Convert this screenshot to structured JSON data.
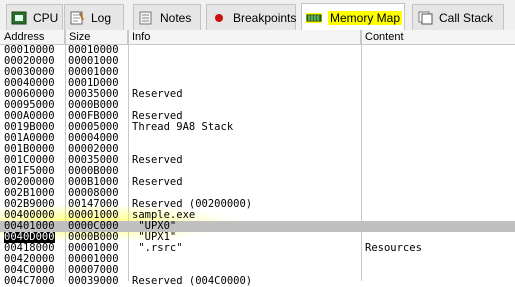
{
  "tabs": [
    {
      "label": "CPU",
      "icon": "cpu-icon",
      "active": false
    },
    {
      "label": "Log",
      "icon": "log-icon",
      "active": false
    },
    {
      "label": "Notes",
      "icon": "notes-icon",
      "active": false
    },
    {
      "label": "Breakpoints",
      "icon": "breakpoint-icon",
      "active": false
    },
    {
      "label": "Memory Map",
      "icon": "memory-map-icon",
      "active": true
    },
    {
      "label": "Call Stack",
      "icon": "call-stack-icon",
      "active": false
    }
  ],
  "columns": [
    "Address",
    "Size",
    "Info",
    "Content"
  ],
  "rows": [
    {
      "address": "00010000",
      "size": "00010000",
      "info": "",
      "content": ""
    },
    {
      "address": "00020000",
      "size": "00001000",
      "info": "",
      "content": ""
    },
    {
      "address": "00030000",
      "size": "00001000",
      "info": "",
      "content": ""
    },
    {
      "address": "00040000",
      "size": "0001D000",
      "info": "",
      "content": ""
    },
    {
      "address": "00060000",
      "size": "00035000",
      "info": "Reserved",
      "content": ""
    },
    {
      "address": "00095000",
      "size": "0000B000",
      "info": "",
      "content": ""
    },
    {
      "address": "000A0000",
      "size": "000FB000",
      "info": "Reserved",
      "content": ""
    },
    {
      "address": "0019B000",
      "size": "00005000",
      "info": "Thread 9A8 Stack",
      "content": ""
    },
    {
      "address": "001A0000",
      "size": "00004000",
      "info": "",
      "content": ""
    },
    {
      "address": "001B0000",
      "size": "00002000",
      "info": "",
      "content": ""
    },
    {
      "address": "001C0000",
      "size": "00035000",
      "info": "Reserved",
      "content": ""
    },
    {
      "address": "001F5000",
      "size": "0000B000",
      "info": "",
      "content": ""
    },
    {
      "address": "00200000",
      "size": "000B1000",
      "info": "Reserved",
      "content": ""
    },
    {
      "address": "002B1000",
      "size": "00008000",
      "info": "",
      "content": ""
    },
    {
      "address": "002B9000",
      "size": "00147000",
      "info": "Reserved (00200000)",
      "content": ""
    },
    {
      "address": "00400000",
      "size": "00001000",
      "info": "sample.exe",
      "content": ""
    },
    {
      "address": "00401000",
      "size": "0000C000",
      "info": " \"UPX0\"",
      "content": ""
    },
    {
      "address": "0040D000",
      "size": "0000B000",
      "info": " \"UPX1\"",
      "content": ""
    },
    {
      "address": "00418000",
      "size": "00001000",
      "info": " \".rsrc\"",
      "content": "Resources"
    },
    {
      "address": "00420000",
      "size": "00001000",
      "info": "",
      "content": ""
    },
    {
      "address": "004C0000",
      "size": "00007000",
      "info": "",
      "content": ""
    },
    {
      "address": "004C7000",
      "size": "00039000",
      "info": "Reserved (004C0000)",
      "content": ""
    }
  ],
  "colors": {
    "highlight": "#ffff00",
    "selected": "#c0c0c0",
    "tab_bg": "#f0f0f0"
  }
}
